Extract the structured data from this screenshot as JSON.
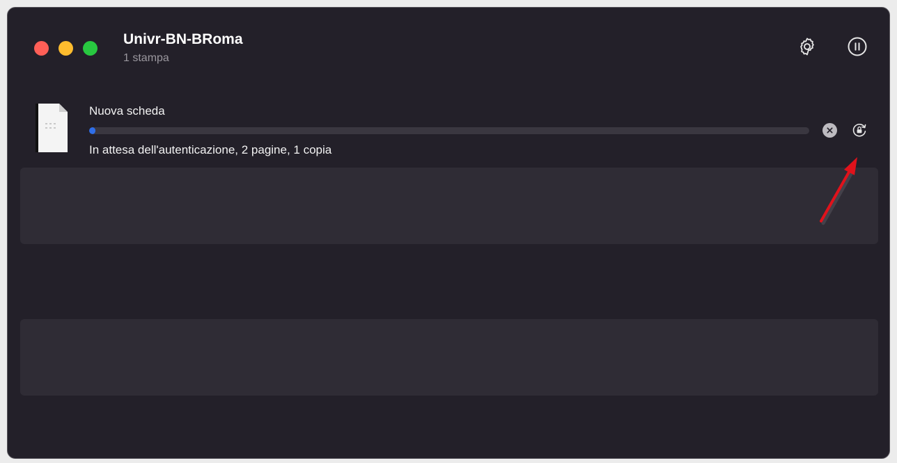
{
  "printer": {
    "name": "Univr-BN-BRoma",
    "job_count": "1 stampa"
  },
  "toolbar": {
    "settings_icon": "gear-icon",
    "pause_icon": "pause-circle-icon"
  },
  "job": {
    "name": "Nuova scheda",
    "status": "In attesa dell'autenticazione, 2 pagine, 1 copia",
    "progress_fraction": 0.0,
    "cancel_icon": "close-circle-icon",
    "auth_icon": "lock-refresh-icon"
  },
  "colors": {
    "close": "#ff5f57",
    "minimize": "#febc2e",
    "zoom": "#28c840",
    "progress": "#2f6ee8",
    "annotation_arrow": "#e0121b"
  }
}
